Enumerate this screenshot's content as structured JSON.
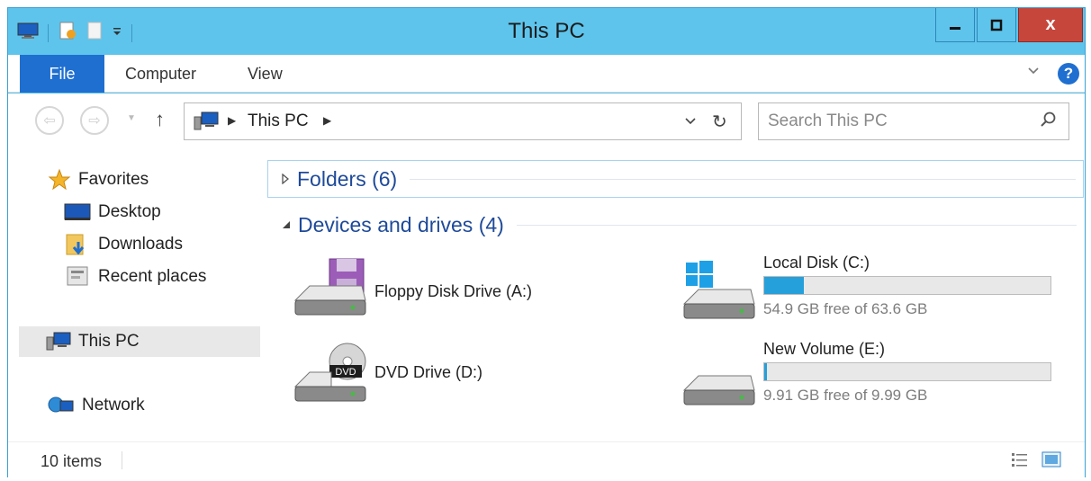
{
  "window": {
    "title": "This PC",
    "close_glyph": "x",
    "min_glyph": "_",
    "max_glyph": "□"
  },
  "qat": {
    "icons": [
      "this-pc-icon",
      "properties-icon",
      "new-folder-icon",
      "customize-qat-icon"
    ]
  },
  "ribbon": {
    "tabs": [
      {
        "label": "File",
        "active": true
      },
      {
        "label": "Computer",
        "active": false
      },
      {
        "label": "View",
        "active": false
      }
    ],
    "accent": "#1f6fd1"
  },
  "address": {
    "path": "This PC",
    "search_placeholder": "Search This PC"
  },
  "navpane": {
    "items": [
      {
        "label": "Favorites",
        "icon": "star-icon"
      },
      {
        "label": "Desktop",
        "icon": "desktop-icon"
      },
      {
        "label": "Downloads",
        "icon": "downloads-icon"
      },
      {
        "label": "Recent places",
        "icon": "recent-places-icon"
      },
      {
        "label": "This PC",
        "icon": "this-pc-icon",
        "selected": true
      },
      {
        "label": "Network",
        "icon": "network-icon"
      }
    ]
  },
  "groups": {
    "folders": {
      "title": "Folders (6)",
      "expanded": false
    },
    "devices": {
      "title": "Devices and drives (4)",
      "expanded": true
    }
  },
  "drives": [
    {
      "label": "Floppy Disk Drive (A:)",
      "icon": "floppy-drive-icon"
    },
    {
      "label": "DVD Drive (D:)",
      "icon": "dvd-drive-icon"
    },
    {
      "label": "Local Disk (C:)",
      "icon": "windows-disk-icon",
      "free": "54.9 GB free of 63.6 GB",
      "used_fraction": 0.137
    },
    {
      "label": "New Volume (E:)",
      "icon": "hard-disk-icon",
      "free": "9.91 GB free of 9.99 GB",
      "used_fraction": 0.008
    }
  ],
  "status": {
    "count": "10 items"
  },
  "colors": {
    "titlebar": "#5ec4ec",
    "close_button": "#c6463c",
    "group_title": "#1e4a99",
    "drive_bar": "#26a0da"
  }
}
